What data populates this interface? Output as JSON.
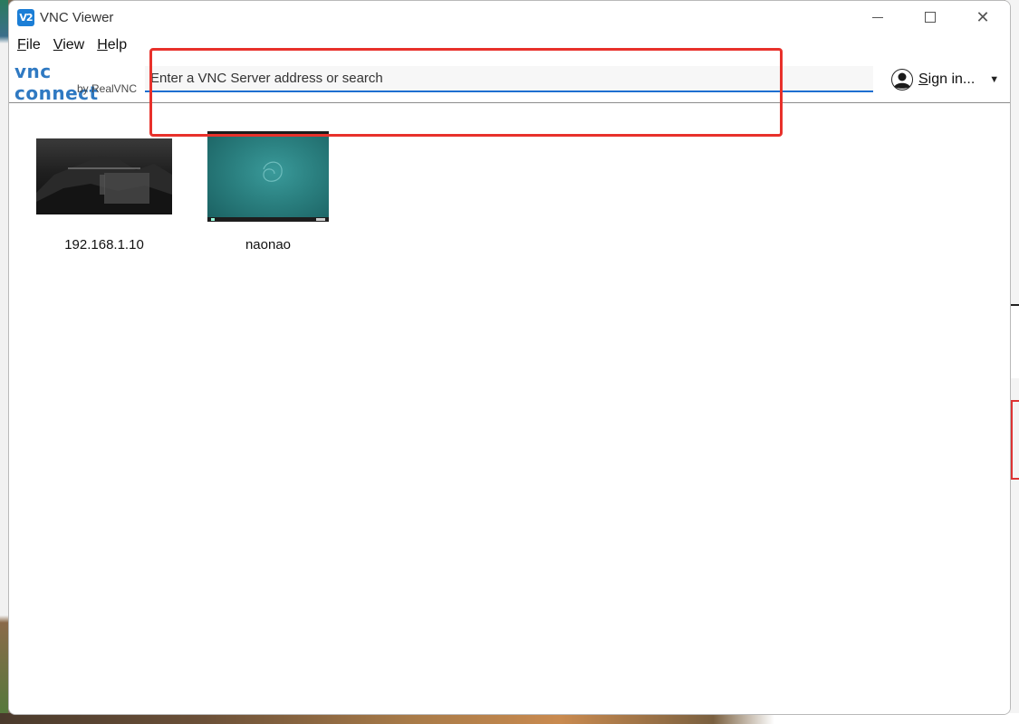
{
  "window": {
    "title": "VNC Viewer",
    "app_icon_text": "V2"
  },
  "menu": [
    {
      "label_acc": "F",
      "label_rest": "ile"
    },
    {
      "label_acc": "V",
      "label_rest": "iew"
    },
    {
      "label_acc": "H",
      "label_rest": "elp"
    }
  ],
  "toolbar": {
    "logo_main": "vnc connect",
    "logo_sub": "by RealVNC",
    "search_placeholder": "Enter a VNC Server address or search",
    "signin_acc": "S",
    "signin_rest": "ign in..."
  },
  "servers": [
    {
      "name": "192.168.1.10"
    },
    {
      "name": "naonao"
    }
  ],
  "colors": {
    "accent": "#1e6fd0",
    "highlight": "#e8312b",
    "logo": "#2f79c2"
  }
}
